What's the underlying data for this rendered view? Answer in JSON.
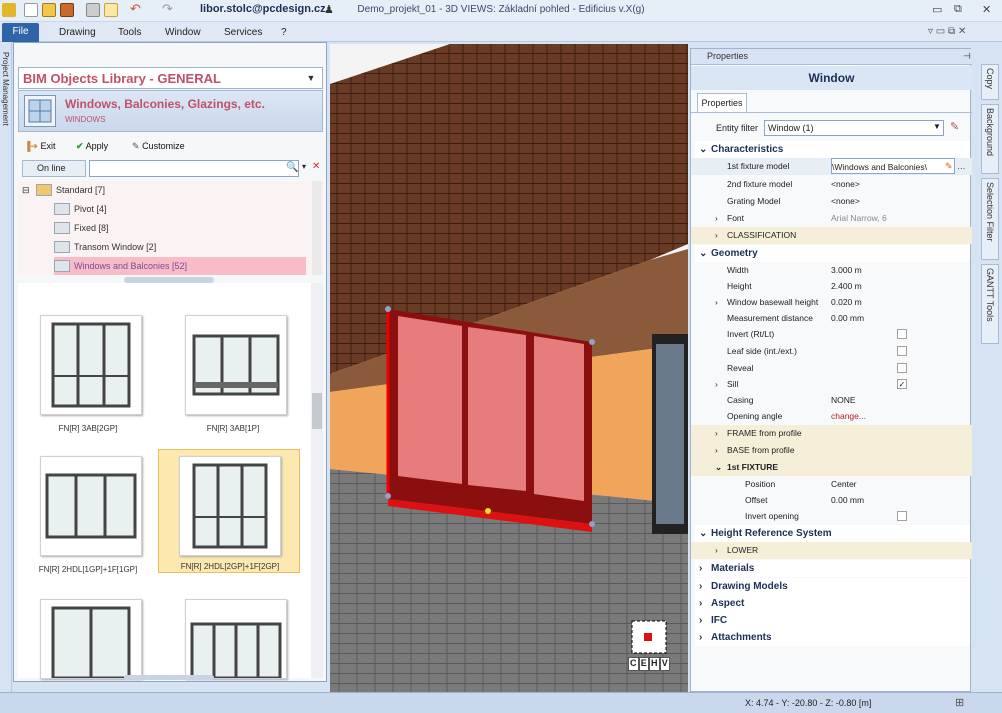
{
  "title_bar": {
    "user": "libor.stolc@pcdesign.cz",
    "title": "Demo_projekt_01 - 3D VIEWS: Základní pohled - Edificius v.X(g)"
  },
  "menu": {
    "file": "File",
    "items": [
      "Drawing",
      "Tools",
      "Window",
      "Services",
      "?"
    ]
  },
  "left_strip": {
    "label": "Project Management"
  },
  "bim_library": {
    "title": "BIM Objects Library - GENERAL",
    "category_title": "Windows, Balconies, Glazings, etc.",
    "category_sub": "WINDOWS",
    "toolbar": {
      "exit": "Exit",
      "apply": "Apply",
      "customize": "Customize"
    },
    "online": "On line",
    "search_value": "",
    "tree": [
      {
        "label": "Standard  [7]"
      },
      {
        "label": "Pivot  [4]"
      },
      {
        "label": "Fixed  [8]"
      },
      {
        "label": "Transom Window  [2]"
      },
      {
        "label": "Windows and Balconies  [52]"
      }
    ],
    "cards": [
      {
        "label": "FN[R] 3AB[2GP]"
      },
      {
        "label": "FN[R] 3AB[1P]"
      },
      {
        "label": "FN[R] 2HDL[1GP]+1F[1GP]"
      },
      {
        "label": "FN[R] 2HDL[2GP]+1F[2GP]"
      },
      {
        "label": ""
      },
      {
        "label": ""
      }
    ]
  },
  "view_cube": {
    "letters": [
      "C",
      "E",
      "H",
      "V"
    ]
  },
  "properties": {
    "tab_label": "Properties",
    "header": "Window",
    "sub_tab": "Properties",
    "entity_filter_label": "Entity filter",
    "entity_filter_value": "Window (1)",
    "sections": {
      "characteristics": "Characteristics",
      "geometry": "Geometry",
      "height_ref": "Height Reference System",
      "materials": "Materials",
      "drawing_models": "Drawing Models",
      "aspect": "Aspect",
      "ifc": "IFC",
      "attachments": "Attachments"
    },
    "rows": {
      "fixture1_name": "1st fixture model",
      "fixture1_val": "\\Windows and Balconies\\",
      "fixture2_name": "2nd fixture model",
      "fixture2_val": "<none>",
      "grating_name": "Grating Model",
      "grating_val": "<none>",
      "font_name": "Font",
      "font_val": "Arial Narrow, 6",
      "classification": "CLASSIFICATION",
      "width_name": "Width",
      "width_val": "3.000 m",
      "height_name": "Height",
      "height_val": "2.400 m",
      "basewall_name": "Window basewall height",
      "basewall_val": "0.020 m",
      "measure_name": "Measurement distance",
      "measure_val": "0.00 mm",
      "invert_name": "Invert (Rt/Lt)",
      "leaf_name": "Leaf side (int./ext.)",
      "reveal_name": "Reveal",
      "sill_name": "Sill",
      "casing_name": "Casing",
      "casing_val": "NONE",
      "angle_name": "Opening angle",
      "angle_val": "change...",
      "frame_profile": "FRAME from profile",
      "base_profile": "BASE from profile",
      "fixture_group": "1st FIXTURE",
      "position_name": "Position",
      "position_val": "Center",
      "offset_name": "Offset",
      "offset_val": "0.00 mm",
      "invert_open_name": "Invert opening",
      "lower": "LOWER"
    }
  },
  "right_tabs": [
    "Copy",
    "Background",
    "Selection Filter",
    "GANTT Tools"
  ],
  "status": {
    "coords": "X: 4.74 - Y: -20.80 - Z: -0.80 [m]"
  }
}
